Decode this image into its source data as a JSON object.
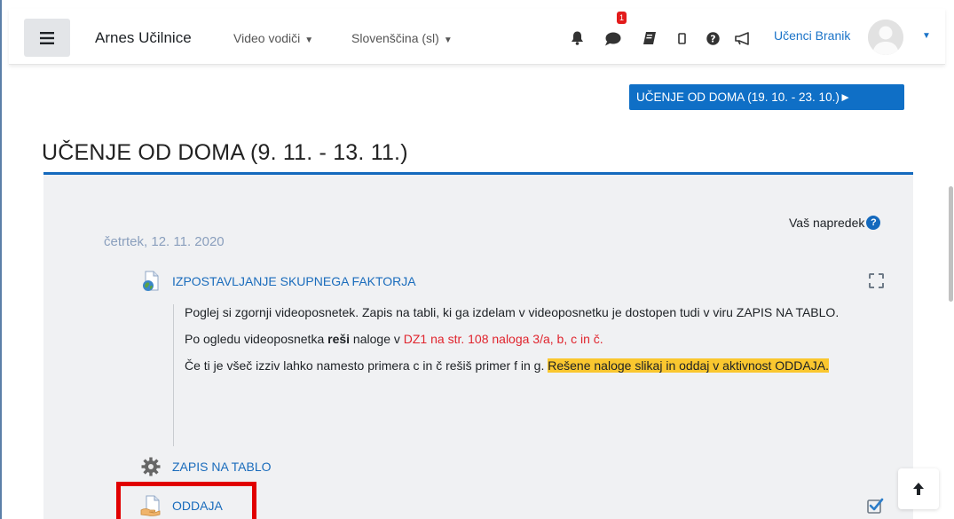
{
  "navbar": {
    "brand": "Arnes Učilnice",
    "links": [
      {
        "label": "Video vodiči",
        "caret": "▼"
      },
      {
        "label": "Slovenščina (sl)",
        "caret": "▼"
      }
    ],
    "message_badge": "1",
    "username": "Učenci Branik",
    "user_caret": "▼",
    "icons": [
      "bell-icon",
      "comment-icon",
      "book-icon",
      "mobile-icon",
      "question-icon",
      "bullhorn-icon"
    ]
  },
  "next_section_button": "UČENJE OD DOMA (19. 10. - 23. 10.)►",
  "section": {
    "title": "UČENJE OD DOMA (9. 11. - 13. 11.)",
    "progress_label": "Vaš napredek",
    "progress_help": "?",
    "date": "četrtek, 12. 11. 2020"
  },
  "activities": [
    {
      "label": "IZPOSTAVLJANJE SKUPNEGA FAKTORJA",
      "icon": "url-icon",
      "completion": "manual-incomplete"
    },
    {
      "label": "ZAPIS NA TABLO",
      "icon": "gear-icon"
    },
    {
      "label": "ODDAJA",
      "icon": "assignment-icon",
      "completion": "auto-complete"
    }
  ],
  "description": {
    "p1": "Poglej si zgornji videoposnetek. Zapis na tabli, ki ga izdelam v videoposnetku je dostopen tudi v viru ZAPIS NA TABLO.",
    "p2_a": "Po ogledu videoposnetka ",
    "p2_bold": "reši",
    "p2_b": " naloge v ",
    "p2_red": "DZ1 na str. 108 naloga 3/a, b, c in č.",
    "p3_a": "Če ti je všeč izziv lahko namesto primera c in č rešiš primer f in g. ",
    "p3_hl": "Rešene naloge slikaj in oddaj v aktivnost ODDAJA."
  },
  "colors": {
    "accent": "#0f6fc6",
    "link": "#1a6cbc",
    "highlight": "#fac72f",
    "annotation_box": "#e10000",
    "badge": "#e31b1b"
  }
}
